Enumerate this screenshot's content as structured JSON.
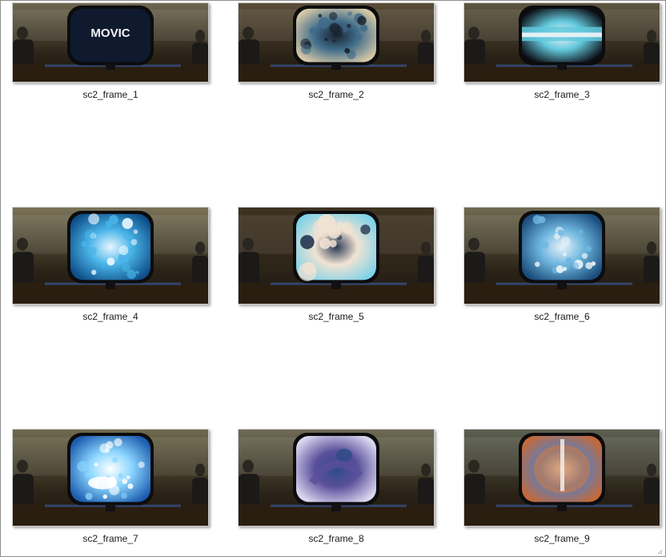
{
  "files": [
    {
      "name": "sc2_frame_1",
      "screen": "logo",
      "logo_text": "MOVIC",
      "ambient": "#6e6850",
      "screen_colors": [
        "#0b1626",
        "#1b2c4a",
        "#e8eef8"
      ]
    },
    {
      "name": "sc2_frame_2",
      "screen": "mixed",
      "ambient": "#5a4e38",
      "screen_colors": [
        "#d7c9a6",
        "#3f6c8a",
        "#1a2330"
      ]
    },
    {
      "name": "sc2_frame_3",
      "screen": "band",
      "ambient": "#5e5640",
      "screen_colors": [
        "#0b0d14",
        "#63c8dc",
        "#f1f5f7"
      ]
    },
    {
      "name": "sc2_frame_4",
      "screen": "bokeh",
      "ambient": "#7a7358",
      "screen_colors": [
        "#0f4f8a",
        "#49b4e8",
        "#e6f6ff"
      ]
    },
    {
      "name": "sc2_frame_5",
      "screen": "cloud",
      "ambient": "#3e3220",
      "screen_colors": [
        "#7fd2e8",
        "#f1e3d3",
        "#2a3b55"
      ]
    },
    {
      "name": "sc2_frame_6",
      "screen": "bokeh",
      "ambient": "#6f6a50",
      "screen_colors": [
        "#1b4d7c",
        "#6fb7df",
        "#e8f2f8"
      ]
    },
    {
      "name": "sc2_frame_7",
      "screen": "burst",
      "ambient": "#6f6a4e",
      "screen_colors": [
        "#1d5db0",
        "#8bd6ff",
        "#ffffff"
      ]
    },
    {
      "name": "sc2_frame_8",
      "screen": "character",
      "ambient": "#6e6a55",
      "screen_colors": [
        "#d9d6ef",
        "#5a4f9a",
        "#2d4c86"
      ]
    },
    {
      "name": "sc2_frame_9",
      "screen": "fire",
      "ambient": "#5c6050",
      "screen_colors": [
        "#c26a3a",
        "#5b7fbf",
        "#f2efe9"
      ]
    }
  ]
}
